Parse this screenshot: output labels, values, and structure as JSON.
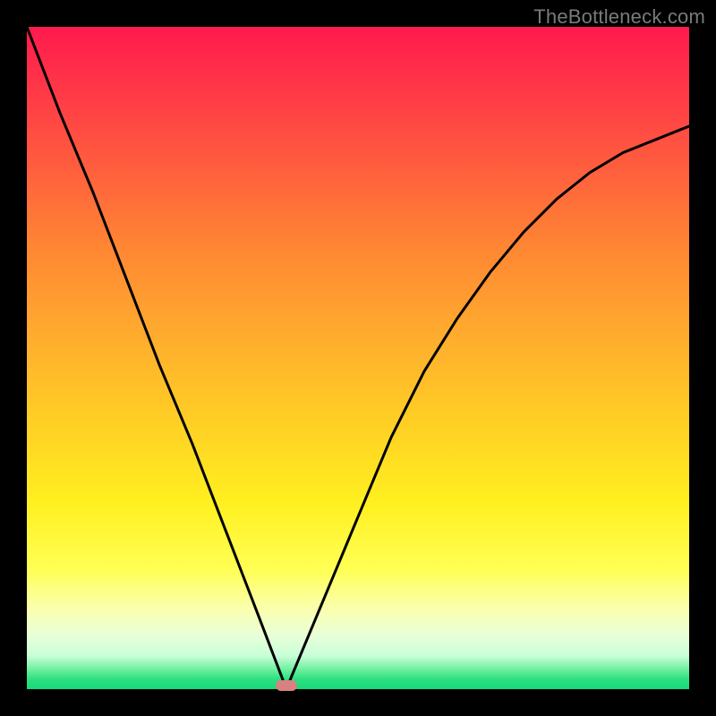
{
  "watermark": "TheBottleneck.com",
  "colors": {
    "frame": "#000000",
    "curve": "#000000",
    "marker": "#d98080"
  },
  "chart_data": {
    "type": "line",
    "title": "",
    "xlabel": "",
    "ylabel": "",
    "x": [
      0.0,
      0.05,
      0.1,
      0.15,
      0.2,
      0.25,
      0.3,
      0.35,
      0.3919,
      0.4,
      0.45,
      0.5,
      0.55,
      0.6,
      0.65,
      0.7,
      0.75,
      0.8,
      0.85,
      0.9,
      0.95,
      1.0
    ],
    "values": [
      1.0,
      0.87,
      0.75,
      0.62,
      0.49,
      0.37,
      0.24,
      0.11,
      0.0,
      0.02,
      0.14,
      0.26,
      0.38,
      0.48,
      0.56,
      0.63,
      0.69,
      0.74,
      0.78,
      0.81,
      0.83,
      0.85
    ],
    "xlim": [
      0,
      1
    ],
    "ylim": [
      0,
      1
    ],
    "marker": {
      "x": 0.3919,
      "y": 0.0
    },
    "background_gradient": [
      "#ff1a4d",
      "#ffd024",
      "#ffff55",
      "#18d878"
    ],
    "note": "y-axis inverted visually (0 at bottom = green, 1 at top = red)"
  }
}
